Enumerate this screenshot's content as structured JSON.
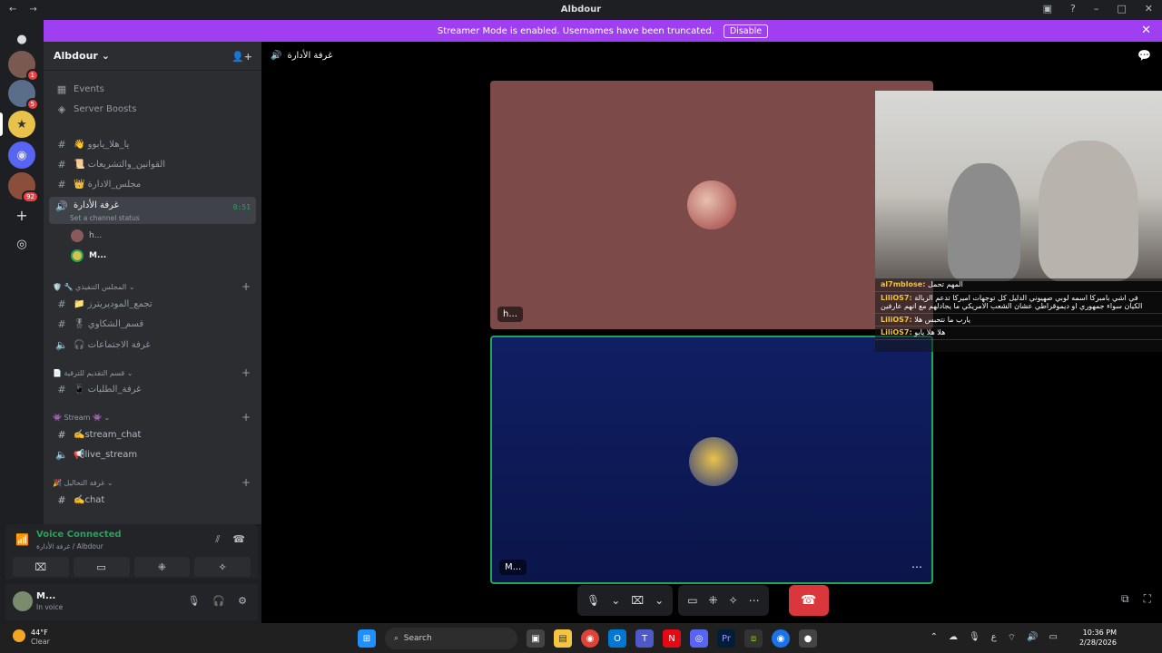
{
  "titlebar": {
    "title": "Albdour"
  },
  "banner": {
    "text": "Streamer Mode is enabled. Usernames have been truncated.",
    "button": "Disable"
  },
  "server": {
    "name": "Albdour",
    "top_items": [
      {
        "label": "Events"
      },
      {
        "label": "Server Boosts"
      }
    ],
    "channels": [
      {
        "label": "👋 يا_هلا_يابوو",
        "type": "text"
      },
      {
        "label": "📜 القوانين_والتشريعات",
        "type": "text"
      },
      {
        "label": "👑 مجلس_الادارة",
        "type": "text"
      }
    ],
    "active_voice": {
      "label": "غرفة الأدارة",
      "timer": "0:51",
      "status": "Set a channel status"
    },
    "members": [
      {
        "name": "h..."
      },
      {
        "name": "M..."
      }
    ],
    "categories": [
      {
        "label": "🛡️ 🔧 المجلس التنفيذي",
        "channels": [
          {
            "label": "📁 تجمع_الموديريترز",
            "type": "text"
          },
          {
            "label": "🎖 قسم_الشكاوي",
            "type": "text"
          },
          {
            "label": "🎧 غرفة الاجتماعات",
            "type": "voice"
          }
        ]
      },
      {
        "label": "📄 قسم التقديم للترقية",
        "channels": [
          {
            "label": "📱 غرفة_الطلبات",
            "type": "text"
          }
        ]
      },
      {
        "label": "👾 Stream 👾",
        "channels": [
          {
            "label": "✍️stream_chat",
            "type": "text"
          },
          {
            "label": "📢live_stream",
            "type": "voice"
          }
        ]
      },
      {
        "label": "🎉 غرفة التحاليل",
        "channels": [
          {
            "label": "✍️chat",
            "type": "text"
          }
        ]
      }
    ]
  },
  "voice": {
    "title": "Voice Connected",
    "subtitle": "غرفة الأدارة / Albdour"
  },
  "user": {
    "name": "M...",
    "status": "In voice"
  },
  "channel_header": {
    "title": "غرفة الأدارة"
  },
  "tiles": [
    {
      "name": "h...",
      "bg": "#7d4a4a"
    },
    {
      "name": "M...",
      "bg": "#101f63"
    }
  ],
  "stream_chat": [
    {
      "user": "al7mblose:",
      "text": "المهم تحمل"
    },
    {
      "user": "LiliOS7:",
      "text": "في اشي بامبركا اسمه لوبي صهيوني الدليل كل توجهات اميركا تدعم الزبالة الكيان سواء جمهوري او ديموقراطي عشان الشعب الامريكي ما يجادلهم مع انهم عارفين"
    },
    {
      "user": "LiliOS7:",
      "text": "يارب ما نتحبس هلا"
    },
    {
      "user": "LiliOS7:",
      "text": "هلا هلا يابو"
    }
  ],
  "taskbar": {
    "weather_temp": "44°F",
    "weather_desc": "Clear",
    "search_placeholder": "Search",
    "time": "10:36 PM",
    "date": "2/28/2026"
  },
  "colors": {
    "accent": "#a03ef2",
    "connected": "#23a559",
    "hangup": "#da373c"
  }
}
